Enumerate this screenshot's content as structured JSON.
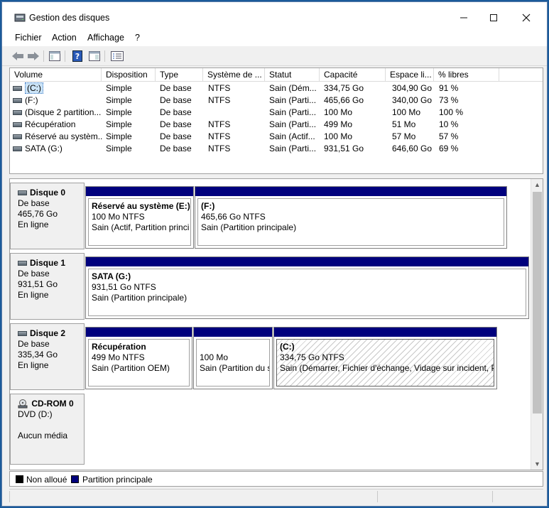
{
  "window": {
    "title": "Gestion des disques",
    "minimize_icon": "minimize-icon",
    "maximize_icon": "maximize-icon",
    "close_icon": "close-icon"
  },
  "menu": [
    "Fichier",
    "Action",
    "Affichage",
    "?"
  ],
  "toolbar": [
    "back-arrow-icon",
    "forward-arrow-icon",
    "console-tree-icon",
    "help-icon",
    "properties-icon"
  ],
  "columns": [
    "Volume",
    "Disposition",
    "Type",
    "Système de ...",
    "Statut",
    "Capacité",
    "Espace li...",
    "% libres"
  ],
  "volumes": [
    {
      "volume": "(C:)",
      "disposition": "Simple",
      "type": "De base",
      "fs": "NTFS",
      "statut": "Sain (Dém...",
      "capacite": "334,75 Go",
      "espace": "304,90 Go",
      "libres": "91 %"
    },
    {
      "volume": "(F:)",
      "disposition": "Simple",
      "type": "De base",
      "fs": "NTFS",
      "statut": "Sain (Parti...",
      "capacite": "465,66 Go",
      "espace": "340,00 Go",
      "libres": "73 %"
    },
    {
      "volume": "(Disque 2 partition...",
      "disposition": "Simple",
      "type": "De base",
      "fs": "",
      "statut": "Sain (Parti...",
      "capacite": "100 Mo",
      "espace": "100 Mo",
      "libres": "100 %"
    },
    {
      "volume": "Récupération",
      "disposition": "Simple",
      "type": "De base",
      "fs": "NTFS",
      "statut": "Sain (Parti...",
      "capacite": "499 Mo",
      "espace": "51 Mo",
      "libres": "10 %"
    },
    {
      "volume": "Réservé au systèm...",
      "disposition": "Simple",
      "type": "De base",
      "fs": "NTFS",
      "statut": "Sain (Actif...",
      "capacite": "100 Mo",
      "espace": "57 Mo",
      "libres": "57 %"
    },
    {
      "volume": "SATA (G:)",
      "disposition": "Simple",
      "type": "De base",
      "fs": "NTFS",
      "statut": "Sain (Parti...",
      "capacite": "931,51 Go",
      "espace": "646,60 Go",
      "libres": "69 %"
    }
  ],
  "disks": [
    {
      "name": "Disque 0",
      "type": "De base",
      "size": "465,76 Go",
      "status": "En ligne",
      "partitions": [
        {
          "title": "Réservé au système  (E:)",
          "size": "100 Mo NTFS",
          "status": "Sain (Actif, Partition princi"
        },
        {
          "title": "(F:)",
          "size": "465,66 Go NTFS",
          "status": "Sain (Partition principale)"
        }
      ]
    },
    {
      "name": "Disque 1",
      "type": "De base",
      "size": "931,51 Go",
      "status": "En ligne",
      "partitions": [
        {
          "title": "SATA  (G:)",
          "size": "931,51 Go NTFS",
          "status": "Sain (Partition principale)"
        }
      ]
    },
    {
      "name": "Disque 2",
      "type": "De base",
      "size": "335,34 Go",
      "status": "En ligne",
      "partitions": [
        {
          "title": "Récupération",
          "size": "499 Mo NTFS",
          "status": "Sain (Partition OEM)"
        },
        {
          "title": "",
          "size": "100 Mo",
          "status": "Sain (Partition du s"
        },
        {
          "title": "(C:)",
          "size": "334,75 Go NTFS",
          "status": "Sain (Démarrer, Fichier d'échange, Vidage sur incident, P"
        }
      ]
    },
    {
      "name": "CD-ROM 0",
      "type": "DVD (D:)",
      "size": "",
      "status": "Aucun média",
      "partitions": []
    }
  ],
  "legend": [
    {
      "label": "Non alloué",
      "color": "#000000"
    },
    {
      "label": "Partition principale",
      "color": "#00007d"
    }
  ],
  "colors": {
    "partition_bar": "#00007d",
    "selection": "#cce4f7"
  }
}
